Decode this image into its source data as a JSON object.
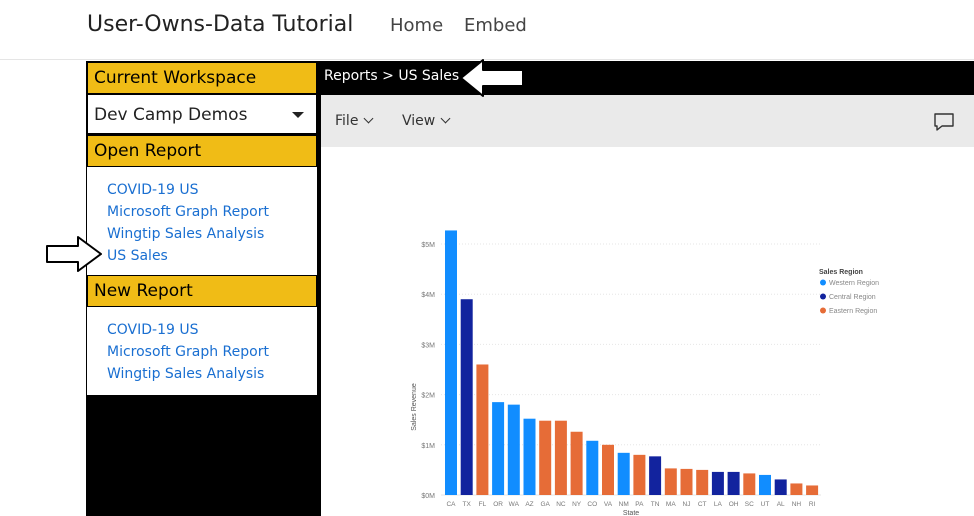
{
  "app": {
    "title": "User-Owns-Data Tutorial",
    "nav": [
      "Home",
      "Embed"
    ]
  },
  "sidebar": {
    "workspace_header": "Current Workspace",
    "workspace_selected": "Dev Camp Demos",
    "open_report_header": "Open Report",
    "open_reports": [
      "COVID-19 US",
      "Microsoft Graph Report",
      "Wingtip Sales Analysis",
      "US Sales"
    ],
    "new_report_header": "New Report",
    "new_reports": [
      "COVID-19 US",
      "Microsoft Graph Report",
      "Wingtip Sales Analysis"
    ]
  },
  "breadcrumb": "Reports > US Sales",
  "toolbar": {
    "file_label": "File",
    "view_label": "View"
  },
  "icons": [
    "chevron-down-icon",
    "comment-icon",
    "arrow-left-icon",
    "arrow-right-icon"
  ],
  "colors": {
    "accent_header": "#f0bc16",
    "link": "#1a6fd1",
    "Western Region": "#118dff",
    "Central Region": "#12239e",
    "Eastern Region": "#e66c37"
  },
  "chart_data": {
    "type": "bar",
    "xlabel": "State",
    "ylabel": "Sales Revenue",
    "ylim": [
      0,
      5.5
    ],
    "yticks": [
      0,
      1,
      2,
      3,
      4,
      5
    ],
    "ytick_labels": [
      "$0M",
      "$1M",
      "$2M",
      "$3M",
      "$4M",
      "$5M"
    ],
    "legend_title": "Sales Region",
    "legend": [
      "Western Region",
      "Central Region",
      "Eastern Region"
    ],
    "categories": [
      "CA",
      "TX",
      "FL",
      "OR",
      "WA",
      "AZ",
      "GA",
      "NC",
      "NY",
      "CO",
      "VA",
      "NM",
      "PA",
      "TN",
      "MA",
      "NJ",
      "CT",
      "LA",
      "OH",
      "SC",
      "UT",
      "AL",
      "NH",
      "RI"
    ],
    "values": [
      5.27,
      3.9,
      2.6,
      1.85,
      1.8,
      1.52,
      1.48,
      1.48,
      1.26,
      1.08,
      1.0,
      0.84,
      0.8,
      0.77,
      0.53,
      0.52,
      0.5,
      0.46,
      0.46,
      0.43,
      0.4,
      0.31,
      0.23,
      0.19
    ],
    "regions": [
      "Western Region",
      "Central Region",
      "Eastern Region",
      "Western Region",
      "Western Region",
      "Western Region",
      "Eastern Region",
      "Eastern Region",
      "Eastern Region",
      "Western Region",
      "Eastern Region",
      "Western Region",
      "Eastern Region",
      "Central Region",
      "Eastern Region",
      "Eastern Region",
      "Eastern Region",
      "Central Region",
      "Central Region",
      "Eastern Region",
      "Western Region",
      "Central Region",
      "Eastern Region",
      "Eastern Region"
    ]
  }
}
